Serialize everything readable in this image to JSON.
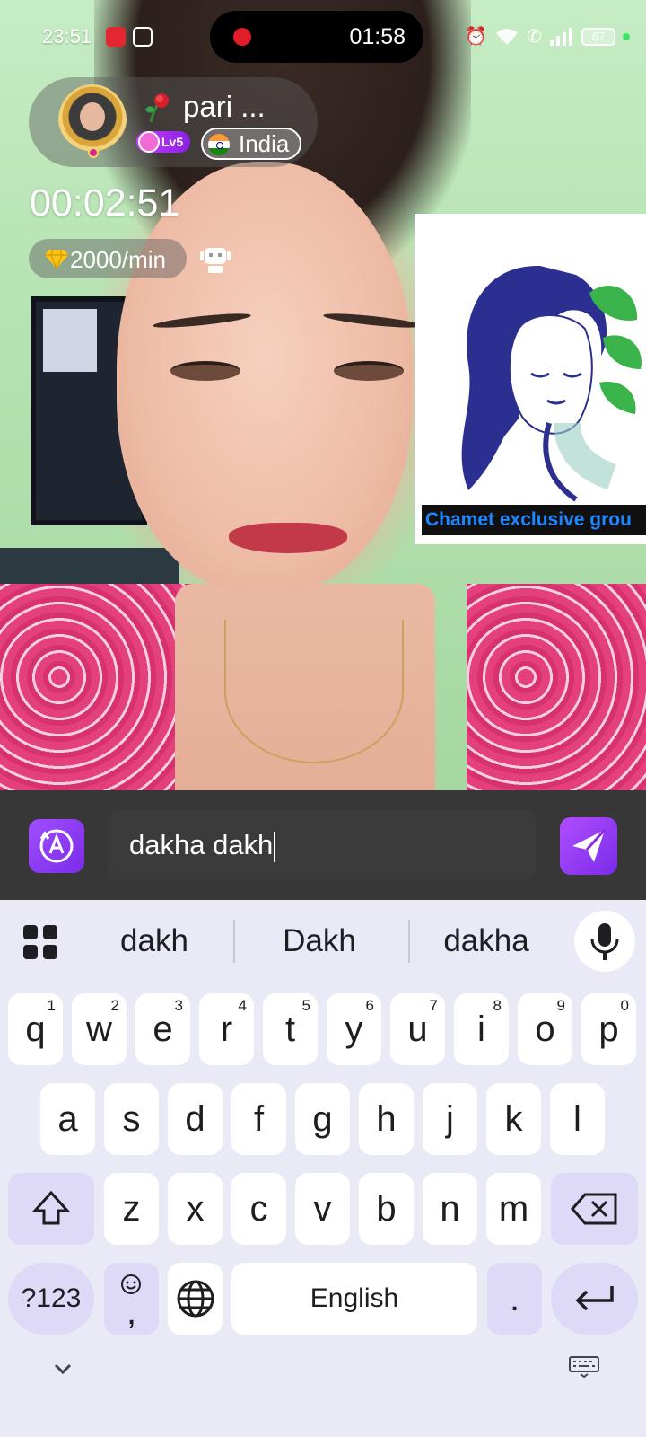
{
  "status_bar": {
    "time": "23:51",
    "record_timer": "01:58",
    "battery": "67"
  },
  "profile": {
    "name": "pari ...",
    "level": "Lv5",
    "country": "India"
  },
  "call": {
    "timer": "00:02:51",
    "rate": "2000/min"
  },
  "pip": {
    "caption": "Chamet exclusive grou"
  },
  "chat_input": {
    "value": "dakha dakh"
  },
  "keyboard": {
    "suggestions": [
      "dakh",
      "Dakh",
      "dakha"
    ],
    "row1": [
      {
        "k": "q",
        "h": "1"
      },
      {
        "k": "w",
        "h": "2"
      },
      {
        "k": "e",
        "h": "3"
      },
      {
        "k": "r",
        "h": "4"
      },
      {
        "k": "t",
        "h": "5"
      },
      {
        "k": "y",
        "h": "6"
      },
      {
        "k": "u",
        "h": "7"
      },
      {
        "k": "i",
        "h": "8"
      },
      {
        "k": "o",
        "h": "9"
      },
      {
        "k": "p",
        "h": "0"
      }
    ],
    "row2": [
      "a",
      "s",
      "d",
      "f",
      "g",
      "h",
      "j",
      "k",
      "l"
    ],
    "row3": [
      "z",
      "x",
      "c",
      "v",
      "b",
      "n",
      "m"
    ],
    "numbers_key": "?123",
    "emoji_key": ",",
    "space_label": "English",
    "period_key": "."
  },
  "colors": {
    "accent_purple": "#8a2be2",
    "keyboard_bg": "#e9eaf6",
    "function_key": "#ddd9f7",
    "caption_blue": "#1f86ff"
  }
}
